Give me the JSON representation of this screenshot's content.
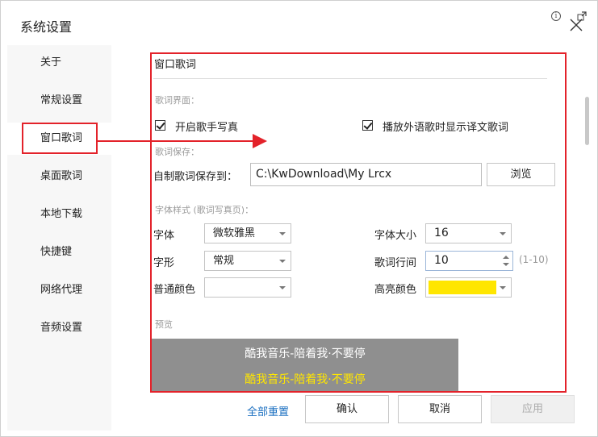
{
  "window": {
    "title": "系统设置",
    "info_icon": "i"
  },
  "sidebar": {
    "items": [
      {
        "label": "关于"
      },
      {
        "label": "常规设置"
      },
      {
        "label": "窗口歌词"
      },
      {
        "label": "桌面歌词"
      },
      {
        "label": "本地下载"
      },
      {
        "label": "快捷键"
      },
      {
        "label": "网络代理"
      },
      {
        "label": "音频设置"
      }
    ],
    "active_index": 2
  },
  "section": {
    "title": "窗口歌词",
    "interface_label": "歌词界面：",
    "show_artist_photo": {
      "label": "开启歌手写真",
      "checked": true
    },
    "show_translation": {
      "label": "播放外语歌时显示译文歌词",
      "checked": true
    },
    "save_label": "歌词保存：",
    "save_path_label": "自制歌词保存到：",
    "save_path_value": "C:\\KwDownload\\My Lrcx",
    "browse_button": "浏览",
    "font_style_label": "字体样式 (歌词写真页)：",
    "font_label": "字体",
    "font_value": "微软雅黑",
    "font_size_label": "字体大小",
    "font_size_value": "16",
    "font_shape_label": "字形",
    "font_shape_value": "常规",
    "line_spacing_label": "歌词行间",
    "line_spacing_value": "10",
    "line_spacing_hint": "(1-10)",
    "normal_color_label": "普通颜色",
    "normal_color_value": "#ffffff",
    "highlight_color_label": "高亮颜色",
    "highlight_color_value": "#ffe600",
    "preview_label": "预览",
    "preview_line1": "酷我音乐-陪着我·不要停",
    "preview_line2": "酷我音乐-陪着我·不要停",
    "preview_bg": "#8f8f8f",
    "preview_line1_color": "#ffffff",
    "preview_line2_color": "#ffe600"
  },
  "footer": {
    "reset_link": "全部重置",
    "ok_button": "确认",
    "cancel_button": "取消",
    "apply_button": "应用"
  },
  "annotation": {
    "color": "#e3222a"
  }
}
